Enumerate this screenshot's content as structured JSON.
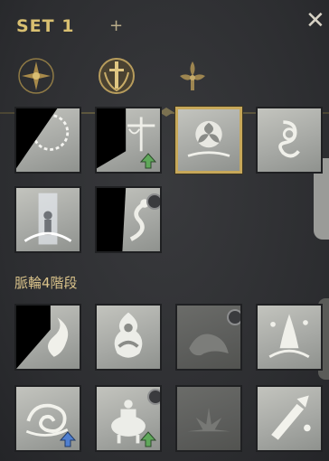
{
  "header": {
    "set_label": "SET 1",
    "add_symbol": "+",
    "close_symbol": "✕"
  },
  "emblems": [
    {
      "icon": "compass-star-emblem-icon"
    },
    {
      "icon": "sword-shield-emblem-icon"
    },
    {
      "icon": "fleur-emblem-icon"
    }
  ],
  "section": {
    "label": "脈輪4階段"
  },
  "colors": {
    "gold": "#d9c071",
    "tile": "#b5b6b2",
    "selected_border": "#c7a85a",
    "upgrade_arrow": "#5fa85a",
    "upgrade_arrow_blue": "#4f7fd0"
  },
  "skills_top": [
    {
      "icon": "thorn-ring-skill-icon",
      "cooldown": true
    },
    {
      "icon": "balance-scale-skill-icon",
      "cooldown": true,
      "upgrade": "green"
    },
    {
      "icon": "triskele-skill-icon",
      "selected": true
    },
    {
      "icon": "knot-skill-icon"
    },
    {
      "icon": "light-pillar-skill-icon"
    },
    {
      "icon": "rising-serpent-skill-icon",
      "cooldown": true,
      "locked": true
    }
  ],
  "skills_bottom": [
    {
      "icon": "flame-wisp-skill-icon",
      "cooldown": true
    },
    {
      "icon": "meditating-figure-skill-icon"
    },
    {
      "icon": "shadow-beast-skill-icon",
      "dim": true,
      "locked": true
    },
    {
      "icon": "praying-hands-skill-icon"
    },
    {
      "icon": "swirl-wind-skill-icon",
      "upgrade": "blue"
    },
    {
      "icon": "incense-burner-skill-icon",
      "locked": true,
      "upgrade": "green"
    },
    {
      "icon": "ground-burst-skill-icon",
      "dim": true
    },
    {
      "icon": "shattered-blade-skill-icon"
    }
  ]
}
